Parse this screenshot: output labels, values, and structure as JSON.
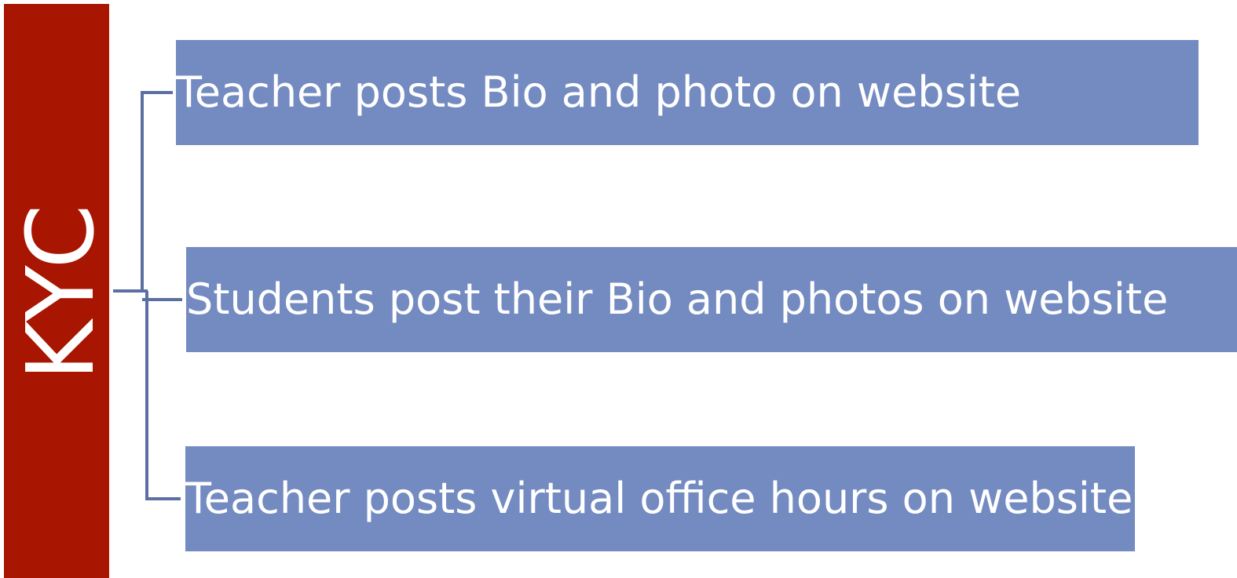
{
  "root": {
    "label": "KYC"
  },
  "branches": [
    {
      "label": "Teacher posts Bio and photo on website"
    },
    {
      "label": "Students post their Bio and photos on website"
    },
    {
      "label": "Teacher posts virtual office hours on website"
    }
  ],
  "colors": {
    "root_fill": "#a81500",
    "branch_fill": "#748bc1",
    "connector": "#5b6fa3",
    "text": "#ffffff"
  }
}
